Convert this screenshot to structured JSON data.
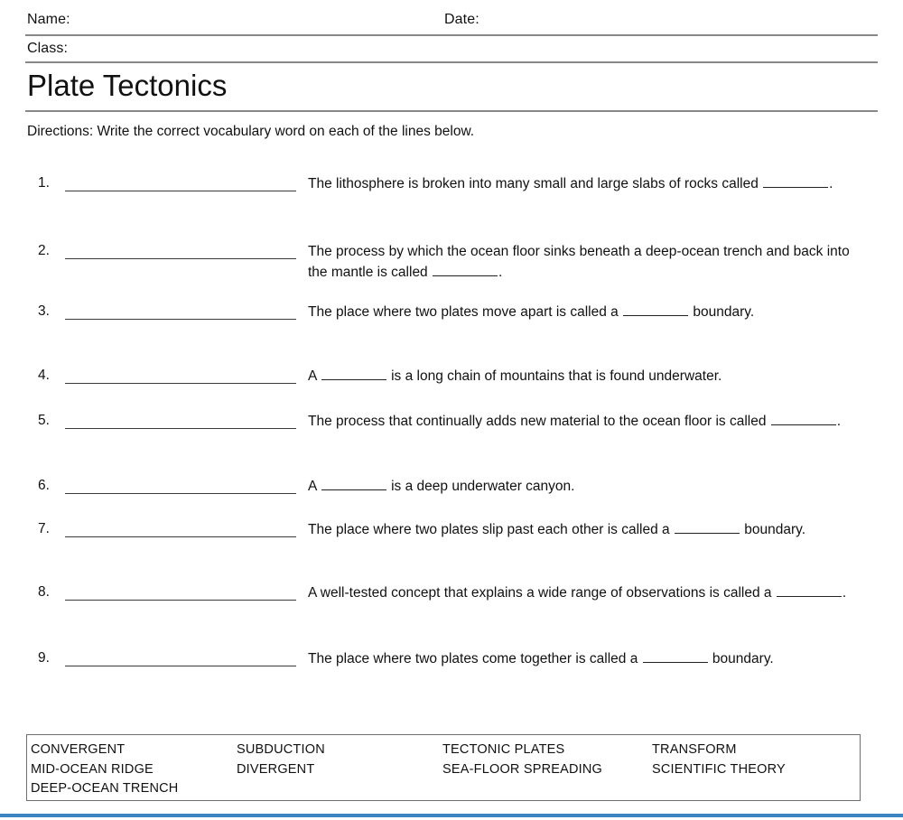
{
  "header": {
    "name_label": "Name:",
    "date_label": "Date:",
    "class_label": "Class:",
    "title": "Plate Tectonics",
    "directions": "Directions: Write the correct vocabulary word on each of the lines below."
  },
  "questions": [
    {
      "number": "1.",
      "text_before": "The lithosphere is broken into many small and large slabs of rocks called ",
      "text_after": ".",
      "full_text": "The lithosphere is broken into many small and large slabs of rocks called ________.",
      "answer": ""
    },
    {
      "number": "2.",
      "text_before": "The process by which the ocean floor sinks beneath a deep-ocean trench and back into the mantle is called ",
      "text_after": ".",
      "full_text": "The process by which the ocean floor sinks beneath a deep-ocean trench and back into the mantle is called ________.",
      "answer": ""
    },
    {
      "number": "3.",
      "text_before": "The place where two plates move apart is called a ",
      "text_after": " boundary.",
      "full_text": "The place where two plates move apart is called a ________ boundary.",
      "answer": ""
    },
    {
      "number": "4.",
      "text_before": "A ",
      "text_after": " is a long chain of mountains that is found underwater.",
      "full_text": "A ________ is a long chain of mountains that is found underwater.",
      "answer": ""
    },
    {
      "number": "5.",
      "text_before": "The process that continually adds new material to the ocean floor is called ",
      "text_after": ".",
      "full_text": "The process that continually adds new material to the ocean floor is called ________.",
      "answer": ""
    },
    {
      "number": "6.",
      "text_before": "A ",
      "text_after": " is a deep underwater canyon.",
      "full_text": "A ________ is a deep underwater canyon.",
      "answer": ""
    },
    {
      "number": "7.",
      "text_before": "The place where two plates slip past each other is called a ",
      "text_after": " boundary.",
      "full_text": "The place where two plates slip past each other is called a ________ boundary.",
      "answer": ""
    },
    {
      "number": "8.",
      "text_before": "A well-tested concept that explains a wide range of observations is called a ",
      "text_after": ".",
      "full_text": "A well-tested concept that explains a wide range of observations is called a ________.",
      "answer": ""
    },
    {
      "number": "9.",
      "text_before": "The place where two plates come together is called a ",
      "text_after": " boundary.",
      "full_text": "The place where two plates come together is called a ________ boundary.",
      "answer": ""
    }
  ],
  "word_bank": {
    "columns": [
      [
        "CONVERGENT",
        "MID-OCEAN RIDGE",
        "DEEP-OCEAN TRENCH"
      ],
      [
        "SUBDUCTION",
        "DIVERGENT"
      ],
      [
        "TECTONIC PLATES",
        "SEA-FLOOR SPREADING"
      ],
      [
        "TRANSFORM",
        "SCIENTIFIC THEORY"
      ]
    ]
  },
  "colors": {
    "accent_bar": "#3b85c4",
    "rule": "#888888",
    "text": "#111111",
    "box_border": "#6f6f6f",
    "page_background": "#ffffff"
  }
}
